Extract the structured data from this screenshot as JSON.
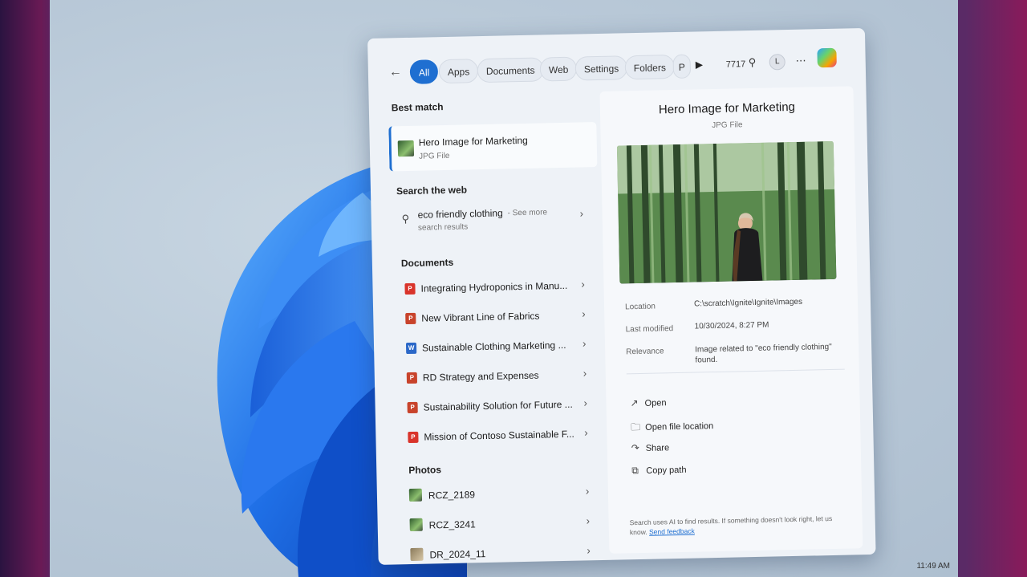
{
  "search": {
    "tabs": [
      "All",
      "Apps",
      "Documents",
      "Web",
      "Settings",
      "Folders",
      "P"
    ],
    "active_tab": "All",
    "points": "7717",
    "avatar_letter": "L"
  },
  "best_match": {
    "section": "Best match",
    "title": "Hero Image for Marketing",
    "subtitle": "JPG File"
  },
  "web": {
    "section": "Search the web",
    "query": "eco friendly clothing",
    "see_more": "- See more",
    "sub": "search results"
  },
  "documents": {
    "section": "Documents",
    "items": [
      {
        "label": "Integrating Hydroponics in Manu...",
        "type": "pdf"
      },
      {
        "label": "New Vibrant Line of Fabrics",
        "type": "ppt"
      },
      {
        "label": "Sustainable Clothing Marketing ...",
        "type": "word"
      },
      {
        "label": "RD Strategy and Expenses",
        "type": "ppt"
      },
      {
        "label": "Sustainability Solution for Future ...",
        "type": "ppt"
      },
      {
        "label": "Mission of Contoso Sustainable F...",
        "type": "pdf"
      }
    ]
  },
  "photos": {
    "section": "Photos",
    "items": [
      "RCZ_2189",
      "RCZ_3241",
      "DR_2024_11"
    ]
  },
  "preview": {
    "title": "Hero Image for Marketing",
    "subtitle": "JPG File",
    "location_label": "Location",
    "location": "C:\\scratch\\Ignite\\Ignite\\Images",
    "modified_label": "Last modified",
    "modified": "10/30/2024, 8:27 PM",
    "relevance_label": "Relevance",
    "relevance": "Image related to \"eco friendly clothing\" found.",
    "actions": [
      "Open",
      "Open file location",
      "Share",
      "Copy path"
    ],
    "footnote": "Search uses AI to find results. If something doesn't look right, let us know.",
    "feedback_link": "Send feedback"
  },
  "taskbar": {
    "time": "11:49 AM"
  },
  "colors": {
    "accent": "#1f6fd1"
  }
}
